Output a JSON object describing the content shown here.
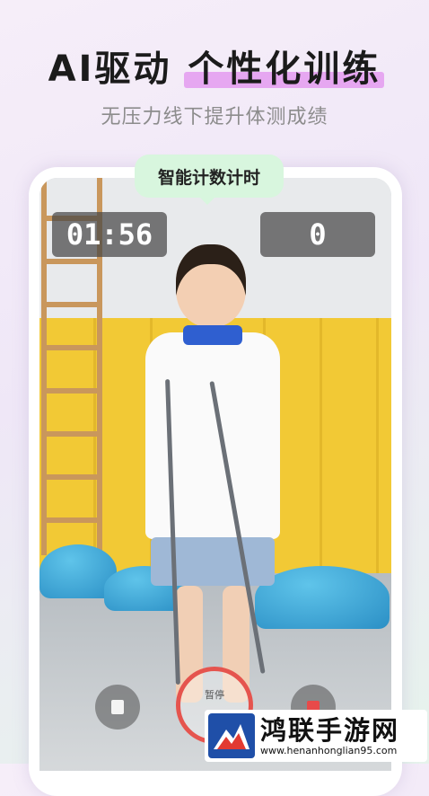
{
  "headline": {
    "part1": "AI驱动",
    "part2": "个性化训练"
  },
  "subtitle": "无压力线下提升体测成绩",
  "bubble": "智能计数计时",
  "timer": "01:56",
  "count": "0",
  "record_label": "暂停",
  "watermark": {
    "title": "鸿联手游网",
    "url": "www.henanhonglian95.com"
  },
  "colors": {
    "highlight": "#e6a7f1",
    "bubble": "#d8f6de",
    "record": "#e5544e"
  },
  "icons": {
    "left_control": "book-icon",
    "right_control": "stop-icon",
    "logo": "horse-logo"
  }
}
